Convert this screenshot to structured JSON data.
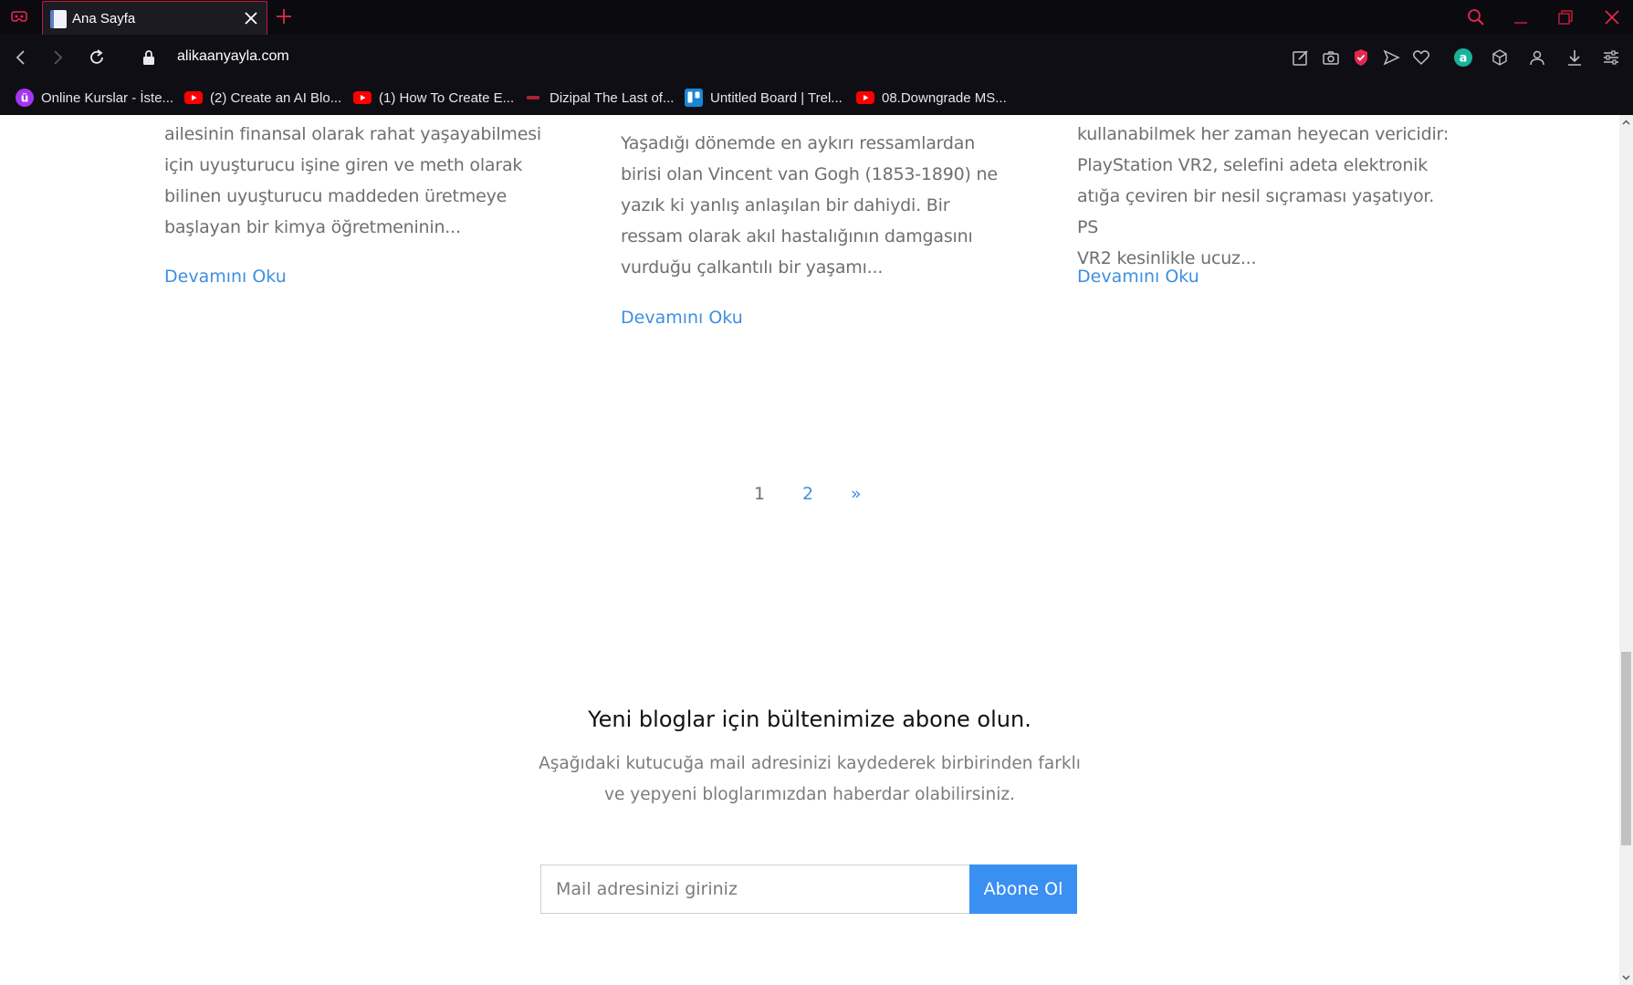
{
  "browser": {
    "tab": {
      "title": "Ana Sayfa"
    },
    "address": {
      "url": "alikaanyayla.com"
    },
    "bookmarks": [
      {
        "label": "Online Kurslar - İste...",
        "icon": "udemy-icon"
      },
      {
        "label": "(2) Create an AI Blo...",
        "icon": "youtube-icon"
      },
      {
        "label": "(1) How To Create E...",
        "icon": "youtube-icon"
      },
      {
        "label": "Dizipal The Last of...",
        "icon": "dizipal-icon"
      },
      {
        "label": "Untitled Board | Trel...",
        "icon": "trello-icon"
      },
      {
        "label": "08.Downgrade MS...",
        "icon": "youtube-icon"
      }
    ],
    "colors": {
      "accent": "#c0193b",
      "chrome_bg": "#0f0e14",
      "tabbar_bg": "#0a0a0f"
    }
  },
  "posts": [
    {
      "excerpt_lines": [
        "ailesinin finansal olarak rahat yaşayabilmesi",
        "için uyuşturucu işine giren ve meth olarak",
        "bilinen uyuşturucu maddeden üretmeye",
        "başlayan bir kimya öğretmeninin..."
      ],
      "read_more": "Devamını Oku"
    },
    {
      "excerpt_lines": [
        "Yaşadığı dönemde en aykırı ressamlardan",
        "birisi olan Vincent van Gogh (1853-1890) ne",
        "yazık ki yanlış anlaşılan bir dahiydi. Bir",
        "ressam olarak akıl hastalığının damgasını",
        "vurduğu çalkantılı bir yaşamı..."
      ],
      "read_more": "Devamını Oku"
    },
    {
      "excerpt_lines": [
        "kullanabilmek her zaman heyecan vericidir:",
        "PlayStation VR2, selefini adeta elektronik",
        "atığa çeviren bir nesil sıçraması yaşatıyor. PS",
        "VR2 kesinlikle ucuz..."
      ],
      "read_more": "Devamını Oku"
    }
  ],
  "pagination": {
    "current": "1",
    "page2": "2",
    "next": "»"
  },
  "newsletter": {
    "title": "Yeni bloglar için bültenimize abone olun.",
    "description": "Aşağıdaki kutucuğa mail adresinizi kaydederek birbirinden farklı ve yepyeni bloglarımızdan haberdar olabilirsiniz.",
    "placeholder": "Mail adresinizi giriniz",
    "button_label": "Abone Ol"
  },
  "page_colors": {
    "link": "#3f8fe0",
    "button": "#3a8ff2",
    "body_text": "#6f6f6f"
  }
}
